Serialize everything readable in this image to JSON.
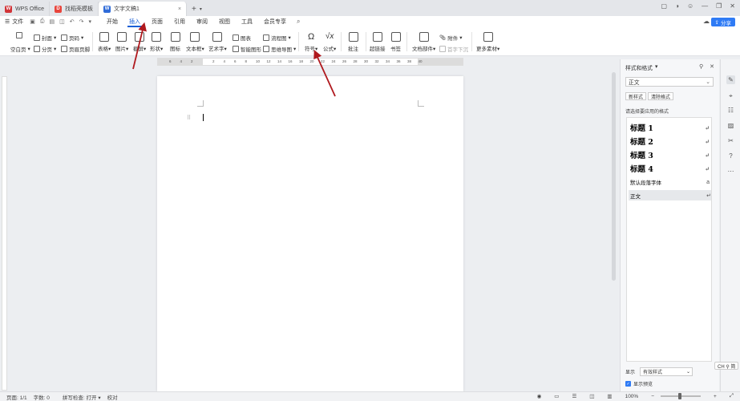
{
  "tabs": [
    {
      "label": "WPS Office",
      "icon": "wps-logo-icon",
      "color": "#d13438"
    },
    {
      "label": "找稻壳模板",
      "icon": "docer-icon",
      "color": "#e8453c"
    },
    {
      "label": "文字文稿1",
      "icon": "word-doc-icon",
      "color": "#2f6bd8"
    }
  ],
  "menu": {
    "file_label": "文件",
    "items": [
      "开始",
      "插入",
      "页面",
      "引用",
      "审阅",
      "视图",
      "工具",
      "会员专享"
    ],
    "active": "插入",
    "share_label": "分享"
  },
  "ribbon": {
    "blank_page": "空白页",
    "cover": "封面",
    "section_break": "分页",
    "page_num": "页码",
    "header_footer": "页眉页脚",
    "table": "表格",
    "picture": "图片",
    "screenshot": "截屏",
    "shape": "形状",
    "icons": "图标",
    "textbox": "文本框",
    "wordart": "艺术字",
    "chart": "图表",
    "smart_shape": "智能图形",
    "flowchart": "流程图",
    "mindmap": "思维导图",
    "symbol": "符号",
    "formula": "公式",
    "comment": "批注",
    "hyperlink": "超链接",
    "bookmark": "书签",
    "doc_parts": "文档部件",
    "attachment": "附件",
    "dropcap": "首字下沉",
    "more_material": "更多素材"
  },
  "ruler": {
    "numbers": [
      "6",
      "4",
      "2",
      "",
      "2",
      "4",
      "6",
      "8",
      "10",
      "12",
      "14",
      "16",
      "18",
      "20",
      "22",
      "24",
      "26",
      "28",
      "30",
      "32",
      "34",
      "36",
      "38",
      "40"
    ]
  },
  "styles_pane": {
    "title": "样式和格式",
    "current_style": "正文",
    "new_style": "新样式",
    "clear_format": "清除格式",
    "hint": "请选择要应用的格式",
    "styles": [
      {
        "label": "标题  1",
        "kind": "heading"
      },
      {
        "label": "标题  2",
        "kind": "heading"
      },
      {
        "label": "标题  3",
        "kind": "heading"
      },
      {
        "label": "标题  4",
        "kind": "heading"
      },
      {
        "label": "默认段落字体",
        "kind": "plain"
      },
      {
        "label": "正文",
        "kind": "selected"
      }
    ],
    "show_label": "显示",
    "show_value": "有效样式",
    "preview_label": "显示预览"
  },
  "ime": "CH ⚲ 简",
  "status": {
    "page": "页面: 1/1",
    "words": "字数: 0",
    "spell": "拼写检查: 打开",
    "proof": "校对",
    "zoom": "100%"
  },
  "colors": {
    "accent": "#1a5fd6",
    "arrow": "#b0191e",
    "share": "#2f7bf5"
  }
}
